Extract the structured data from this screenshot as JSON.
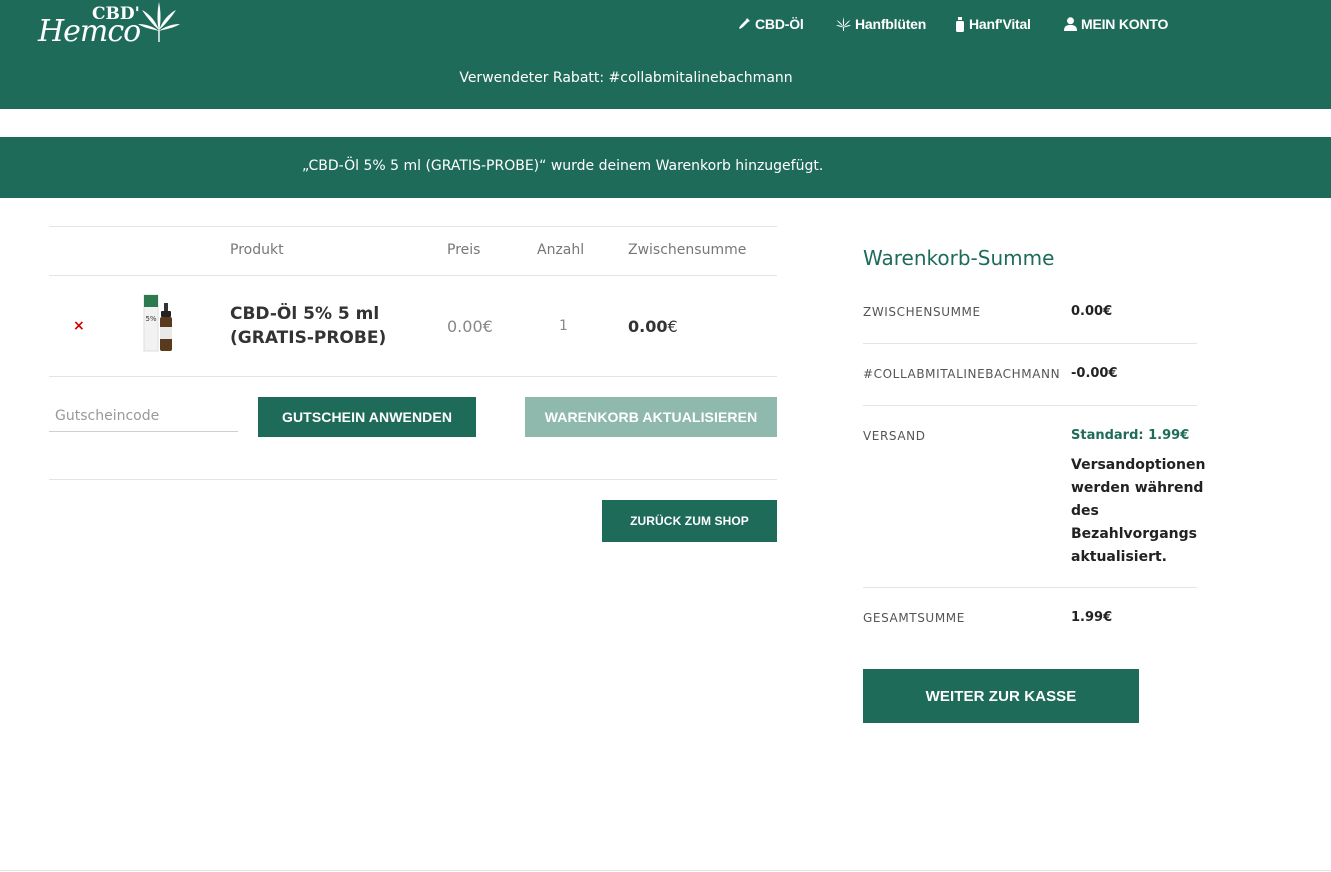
{
  "brand": {
    "top": "CBD'",
    "main": "Hemco"
  },
  "nav": [
    {
      "label": "CBD-Öl",
      "icon": "dropper-icon"
    },
    {
      "label": "Hanfblüten",
      "icon": "cannabis-leaf-icon"
    },
    {
      "label": "Hanf'Vital",
      "icon": "bottle-icon"
    },
    {
      "label": "MEIN KONTO",
      "icon": "user-icon"
    }
  ],
  "discount_notice": "Verwendeter Rabatt: #collabmitalinebachmann",
  "cart_notice": "„CBD-Öl 5% 5 ml (GRATIS-PROBE)“ wurde deinem Warenkorb hinzugefügt.",
  "cart": {
    "headers": {
      "product": "Produkt",
      "price": "Preis",
      "qty": "Anzahl",
      "subtotal": "Zwischensumme"
    },
    "items": [
      {
        "remove": "×",
        "name_line1": "CBD-Öl 5% 5 ml",
        "name_line2": "(GRATIS-PROBE)",
        "thumb_label": "5%",
        "price": "0.00€",
        "qty": "1",
        "subtotal_amount": "0.00",
        "subtotal_currency": "€"
      }
    ],
    "coupon_placeholder": "Gutscheincode",
    "apply_label": "GUTSCHEIN ANWENDEN",
    "update_label": "WARENKORB AKTUALISIEREN",
    "back_label": "ZURÜCK ZUM SHOP"
  },
  "totals": {
    "title": "Warenkorb-Summe",
    "subtotal_label": "ZWISCHENSUMME",
    "subtotal_value": "0.00€",
    "coupon_label": "#COLLABMITALINEBACHMANN",
    "coupon_value": "-0.00€",
    "shipping_label": "VERSAND",
    "shipping_value": "Standard: 1.99€",
    "shipping_note": "Versandoptionen werden während des Bezahlvorgangs aktualisiert.",
    "total_label": "GESAMTSUMME",
    "total_value": "1.99€",
    "checkout_label": "WEITER ZUR KASSE"
  },
  "colors": {
    "brand_green": "#1f6b5a",
    "disabled_green": "#8fb9ad",
    "remove_red": "#d40000"
  }
}
